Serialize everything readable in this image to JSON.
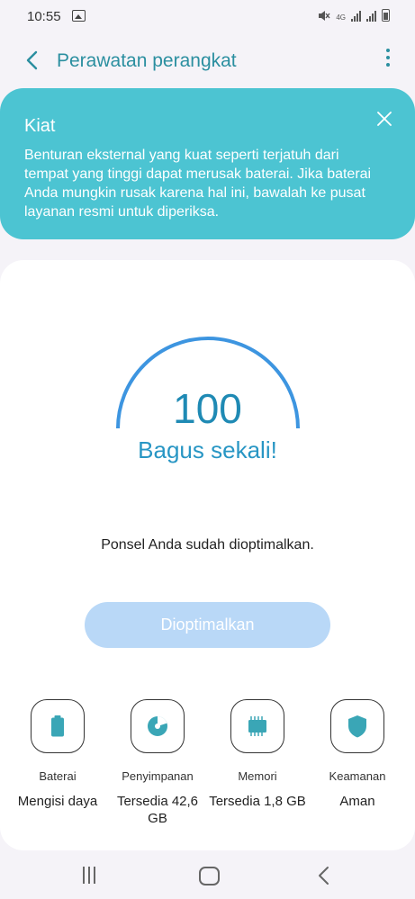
{
  "status_bar": {
    "time": "10:55",
    "network": "4G"
  },
  "header": {
    "title": "Perawatan perangkat"
  },
  "tip": {
    "title": "Kiat",
    "text": "Benturan eksternal yang kuat seperti terjatuh dari tempat yang tinggi dapat merusak baterai. Jika baterai Anda mungkin rusak karena hal ini, bawalah ke pusat layanan resmi untuk diperiksa."
  },
  "score": {
    "value": "100",
    "rating": "Bagus sekali!"
  },
  "message": "Ponsel Anda sudah dioptimalkan.",
  "optimize_button": "Dioptimalkan",
  "categories": [
    {
      "label": "Baterai",
      "value": "Mengisi daya",
      "icon": "battery-icon"
    },
    {
      "label": "Penyimpanan",
      "value": "Tersedia 42,6 GB",
      "icon": "storage-icon"
    },
    {
      "label": "Memori",
      "value": "Tersedia 1,8 GB",
      "icon": "memory-icon"
    },
    {
      "label": "Keamanan",
      "value": "Aman",
      "icon": "shield-icon"
    }
  ],
  "colors": {
    "accent": "#2b8fa0",
    "tip_bg": "#4cc4d2",
    "gauge": "#3d95e0",
    "button_disabled": "#b9d8f7",
    "icon_fill": "#3aa6b6"
  }
}
